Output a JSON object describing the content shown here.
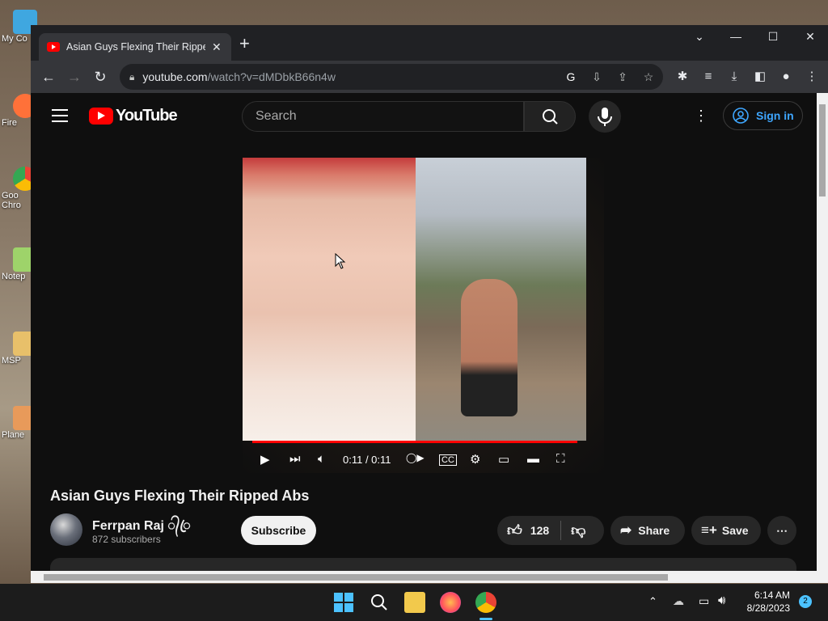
{
  "desktop": {
    "icons": [
      {
        "label": "My Co"
      },
      {
        "label": "Fire"
      },
      {
        "label": "Goo Chro"
      },
      {
        "label": "Notep"
      },
      {
        "label": "MSP"
      },
      {
        "label": "Plane"
      }
    ]
  },
  "browser": {
    "tab": {
      "title": "Asian Guys Flexing Their Ripped Abs"
    },
    "new_tab_label": "+",
    "window_controls": {
      "minimize": "—",
      "maximize": "☐",
      "close": "✕",
      "tab_search": "⌄"
    },
    "address": {
      "host": "youtube.com",
      "path": "/watch?v=dMDbkB66n4w"
    }
  },
  "youtube": {
    "logo_text": "YouTube",
    "search": {
      "placeholder": "Search"
    },
    "signin_label": "Sign in",
    "video": {
      "time": "0:11 / 0:11",
      "progress": 1.0
    },
    "title": "Asian Guys Flexing Their Ripped Abs",
    "channel": {
      "name": "Ferrpan Raj ᭄ꦿ",
      "subscribers": "872 subscribers"
    },
    "subscribe_label": "Subscribe",
    "likes": "128",
    "share_label": "Share",
    "save_label": "Save"
  },
  "taskbar": {
    "time": "6:14 AM",
    "date": "8/28/2023",
    "notifications": "2"
  },
  "colors": {
    "accent": "#ff0000",
    "link": "#3ea6ff",
    "background": "#0f0f0f"
  }
}
